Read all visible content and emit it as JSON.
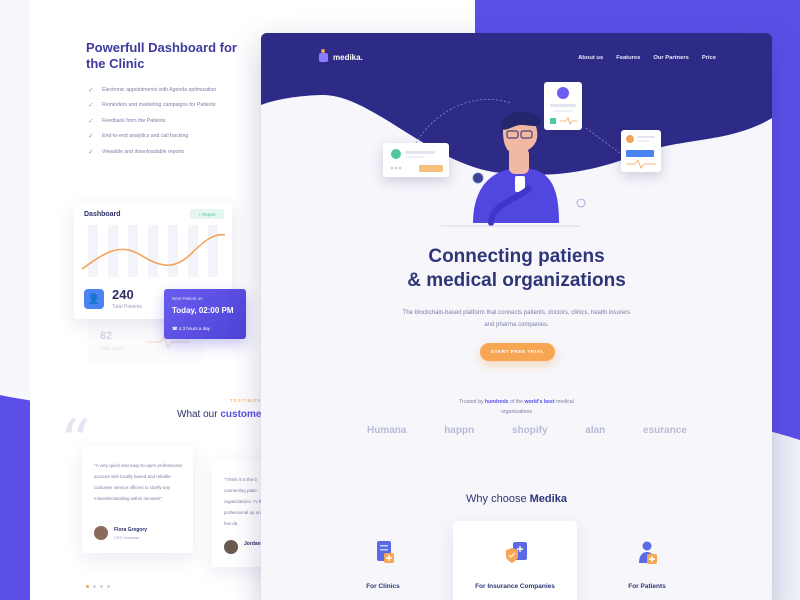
{
  "left_panel": {
    "title": "Powerfull Dashboard for the Clinic",
    "features": [
      "Electronic appointments with Agenda optimization",
      "Reminders and marketing campaigns for Patients",
      "Feedback from the Patients",
      "End-to-end analytics and call tracking",
      "Viewable and downloadable reports"
    ],
    "dashboard": {
      "title": "Dashboard",
      "report_button": "Report",
      "total_patients_value": "240",
      "total_patients_label": "Total Patients",
      "ghost_value": "82",
      "ghost_label": "Total hours"
    },
    "next_patient": {
      "label": "Next Patient on",
      "time": "Today, 02:00 PM",
      "duration": "4.3 hours a day"
    },
    "testimonials": {
      "eyebrow": "TESTIMON",
      "title_prefix": "What our ",
      "title_bold": "custome",
      "cards": [
        {
          "text": "\"A very quick and easy-to-open professional account with locally based and reliable customer service officers to clarify any misunderstanding within minutes!\"",
          "name": "Flora Gregory",
          "role": "CEO Humana"
        },
        {
          "text": "\"I think it is the b connecting patie organizations. I'v this professional up only a few da",
          "name": "Jordan",
          "role": ""
        }
      ]
    }
  },
  "site": {
    "logo": "medika.",
    "nav": [
      "About us",
      "Features",
      "Our Partners",
      "Price"
    ],
    "hero_title_line1": "Connecting patiens",
    "hero_title_line2": "& medical organizations",
    "hero_subtitle": "The blockchain-based platform that connects patients, doctors, clinics, health insurers and pharma companies.",
    "cta": "START FREE TRIAL",
    "trusted_prefix": "Trusted by ",
    "trusted_bold1": "hundreds",
    "trusted_mid": " of the ",
    "trusted_bold2": "world's best",
    "trusted_suffix": " medical organizations",
    "brands": [
      "Humana",
      "happn",
      "shopify",
      "alan",
      "esurance"
    ],
    "why_prefix": "Why choose ",
    "why_bold": "Medika",
    "why_cards": [
      "For Clinics",
      "For Insurance Companies",
      "For Patients"
    ]
  },
  "colors": {
    "primary": "#5b4fe8",
    "navy": "#2f3677",
    "accent_orange": "#f7a653",
    "success_green": "#4fc79b"
  }
}
